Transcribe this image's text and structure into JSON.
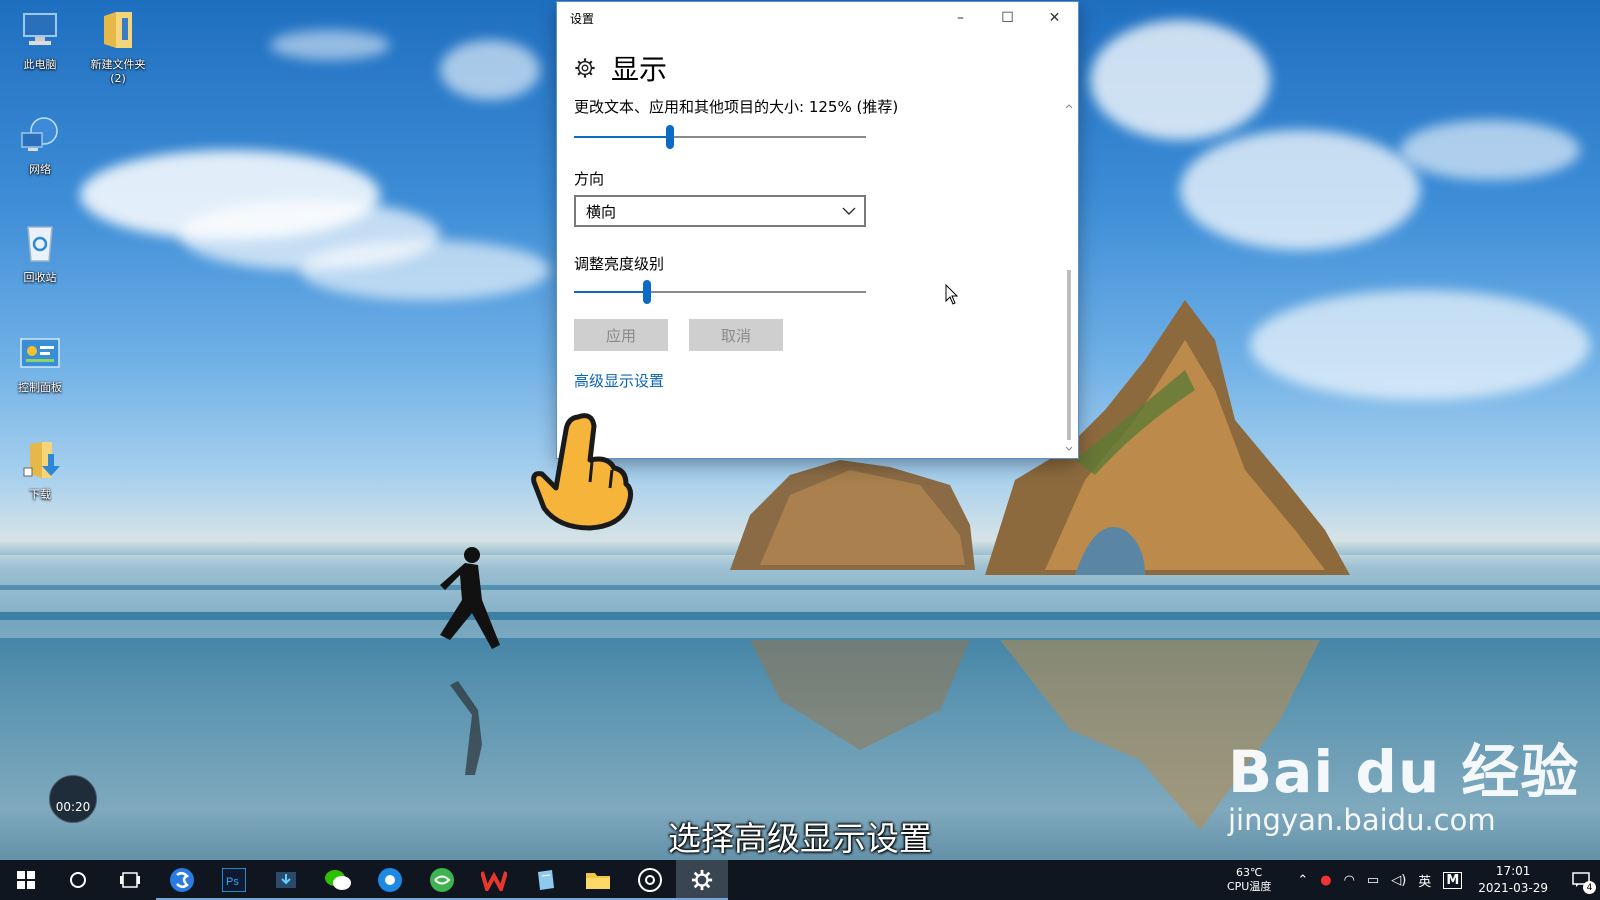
{
  "desktop": {
    "icons": [
      {
        "label": "此电脑",
        "icon": "computer-icon"
      },
      {
        "label": "新建文件夹",
        "sub": "(2)",
        "icon": "folder-icon"
      },
      {
        "label": "网络",
        "icon": "network-icon"
      },
      {
        "label": "回收站",
        "icon": "recycle-bin-icon"
      },
      {
        "label": "控制面板",
        "icon": "control-panel-icon"
      },
      {
        "label": "下载",
        "icon": "download-folder-icon"
      }
    ]
  },
  "window": {
    "title": "设置",
    "controls": {
      "minimize": "–",
      "maximize": "☐",
      "close": "✕"
    },
    "page_title": "显示",
    "scale_label": "更改文本、应用和其他项目的大小: 125% (推荐)",
    "scale_slider_fraction": 0.33,
    "orientation_label": "方向",
    "orientation_value": "横向",
    "brightness_label": "调整亮度级别",
    "brightness_slider_fraction": 0.25,
    "apply_label": "应用",
    "cancel_label": "取消",
    "advanced_link": "高级显示设置"
  },
  "overlay": {
    "caption": "选择高级显示设置",
    "watermark_brand": "Bai du 经验",
    "watermark_url": "jingyan.baidu.com",
    "timer": "00:20"
  },
  "taskbar": {
    "apps": [
      "start-icon",
      "search-icon",
      "task-view-icon",
      "sogou-icon",
      "photoshop-icon",
      "store-download-icon",
      "wechat-icon",
      "browser-icon",
      "360-icon",
      "wps-icon",
      "notepad-icon",
      "file-explorer-icon",
      "music-icon",
      "settings-icon"
    ],
    "cpu_temp": "63℃",
    "cpu_label": "CPU温度",
    "ime": "英",
    "time": "17:01",
    "date": "2021-03-29",
    "notifications": "4"
  },
  "colors": {
    "accent": "#0a6cc4",
    "link": "#0a66b8",
    "taskbar": "#10161f"
  }
}
